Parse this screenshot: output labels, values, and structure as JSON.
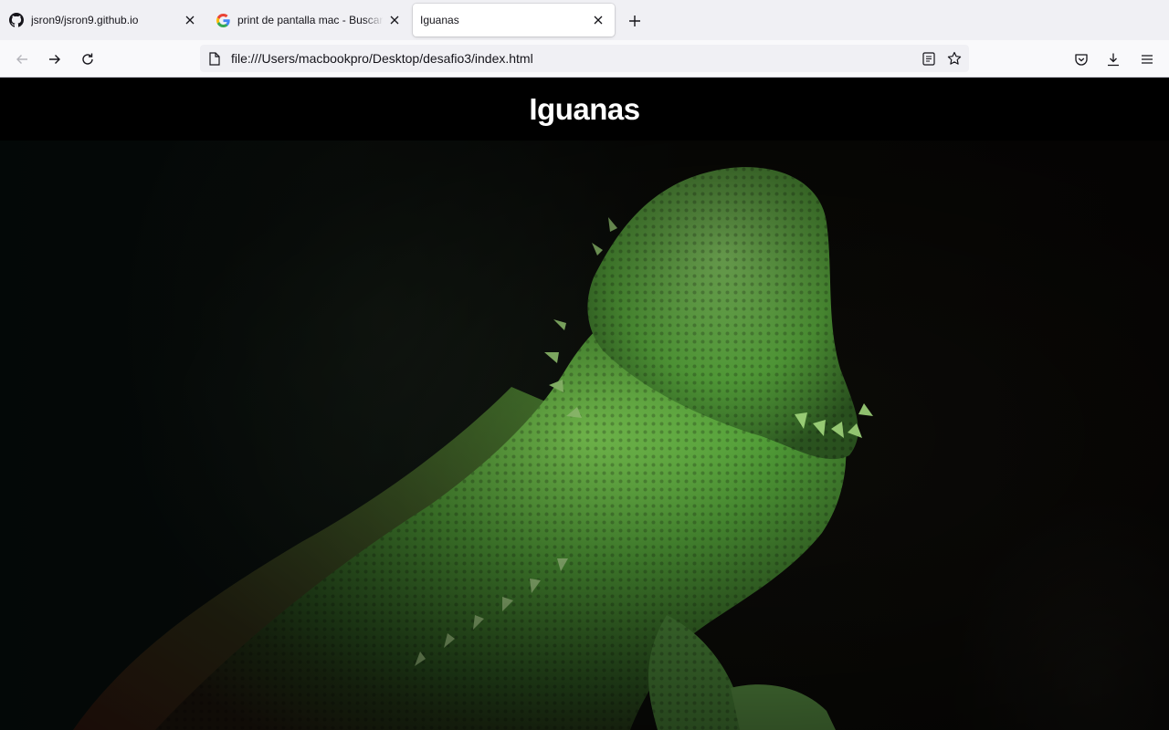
{
  "browser": {
    "tabs": [
      {
        "title": "jsron9/jsron9.github.io",
        "icon": "github-icon",
        "active": false
      },
      {
        "title": "print de pantalla mac - Buscar con Google",
        "icon": "google-icon",
        "active": false
      },
      {
        "title": "Iguanas",
        "icon": "none",
        "active": true
      }
    ],
    "url": "file:///Users/macbookpro/Desktop/desafio3/index.html"
  },
  "page": {
    "title": "Iguanas",
    "hero_image": "bearded-dragon-lizard-photo"
  },
  "colors": {
    "tabstrip_bg": "#f0f0f4",
    "navbar_bg": "#f9f9fb",
    "page_bg": "#000000",
    "title_color": "#ffffff",
    "lizard_green": "#5fae3e"
  }
}
